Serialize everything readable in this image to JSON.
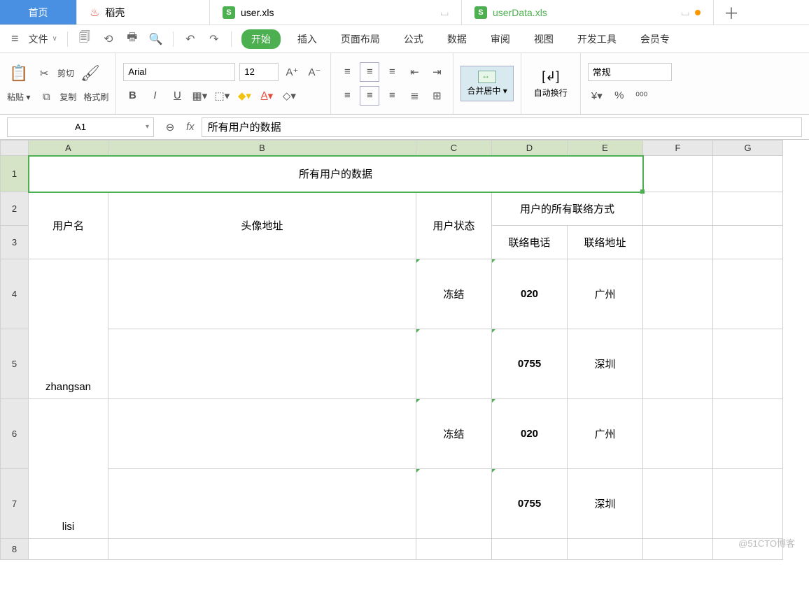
{
  "tabs": {
    "home": "首页",
    "shell": "稻壳",
    "file1": "user.xls",
    "file2": "userData.xls"
  },
  "menu": {
    "file": "文件",
    "ribbon": [
      "开始",
      "插入",
      "页面布局",
      "公式",
      "数据",
      "审阅",
      "视图",
      "开发工具",
      "会员专"
    ]
  },
  "clipboard": {
    "cut": "剪切",
    "paste": "粘贴",
    "copy": "复制",
    "fmtpaint": "格式刷"
  },
  "font": {
    "name": "Arial",
    "size": "12"
  },
  "align": {
    "merge": "合并居中",
    "wrap": "自动换行"
  },
  "number": {
    "format": "常规"
  },
  "namebox": "A1",
  "formula": "所有用户的数据",
  "cols": [
    "A",
    "B",
    "C",
    "D",
    "E",
    "F",
    "G"
  ],
  "rows": [
    "1",
    "2",
    "3",
    "4",
    "5",
    "6",
    "7",
    "8"
  ],
  "cells": {
    "title": "所有用户的数据",
    "h_user": "用户名",
    "h_avatar": "头像地址",
    "h_status": "用户状态",
    "h_contact": "用户的所有联络方式",
    "h_phone": "联络电话",
    "h_addr": "联络地址",
    "u1": "zhangsan",
    "u2": "lisi",
    "s1": "冻结",
    "s2": "冻结",
    "p1": "020",
    "a1": "广州",
    "p2": "0755",
    "a2": "深圳",
    "p3": "020",
    "a3": "广州",
    "p4": "0755",
    "a4": "深圳"
  },
  "watermark": "@51CTO博客"
}
